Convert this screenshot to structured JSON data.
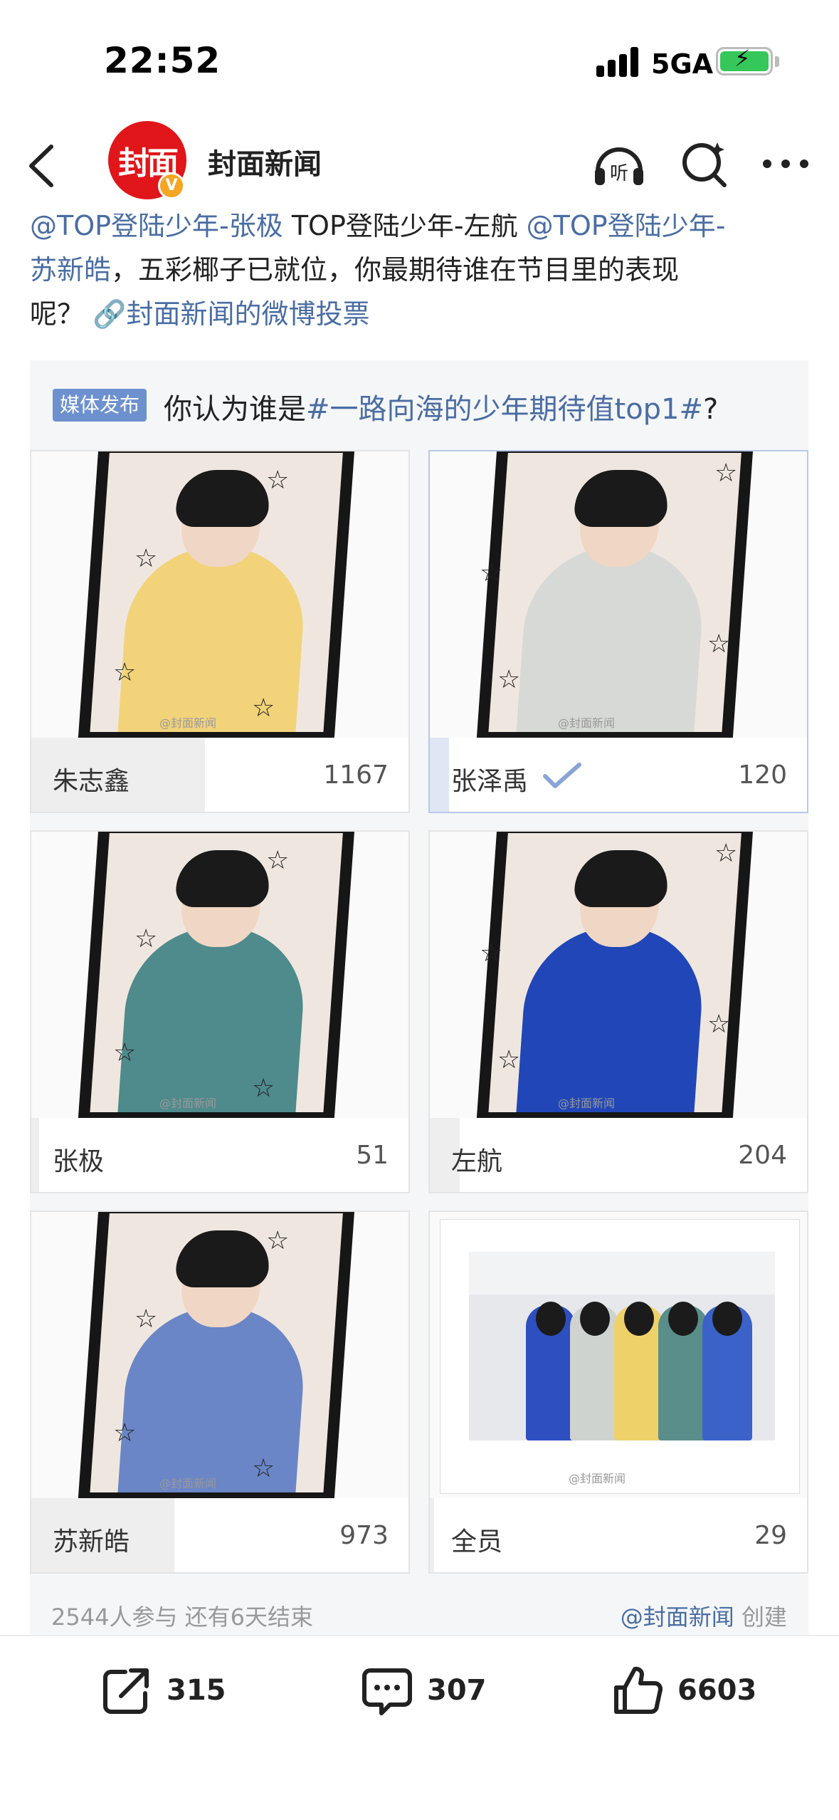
{
  "status_bar": {
    "time": "22:52",
    "network": "5GA"
  },
  "header": {
    "avatar_text": "封面",
    "account_name": "封面新闻"
  },
  "post": {
    "line1_mention1": "@TOP登陆少年-张极",
    "line1_plain": " TOP登陆少年-左航 ",
    "line1_mention2": "@TOP登陆少年-",
    "line2_mention2b": "苏新皓",
    "line2_text": "，五彩椰子已就位，你最期待谁在节目里的表现",
    "line3_text": "呢？",
    "vote_link": "封面新闻的微博投票"
  },
  "poll": {
    "tag": "媒体发布",
    "question_prefix": "你认为谁是",
    "question_topic": "#一路向海的少年期待值top1#",
    "question_suffix": "?",
    "options": [
      {
        "name": "朱志鑫",
        "count": "1167",
        "fraction": 0.46,
        "selected": false,
        "outfit": "#f2d37a"
      },
      {
        "name": "张泽禹",
        "count": "120",
        "fraction": 0.05,
        "selected": true,
        "outfit": "#d7d9d6"
      },
      {
        "name": "张极",
        "count": "51",
        "fraction": 0.02,
        "selected": false,
        "outfit": "#4f8a8c"
      },
      {
        "name": "左航",
        "count": "204",
        "fraction": 0.08,
        "selected": false,
        "outfit": "#2146b8"
      },
      {
        "name": "苏新皓",
        "count": "973",
        "fraction": 0.38,
        "selected": false,
        "outfit": "#6b86c6"
      },
      {
        "name": "全员",
        "count": "29",
        "fraction": 0.01,
        "selected": false,
        "outfit": "#cccccc"
      }
    ],
    "participants": "2544人参与",
    "remaining": "还有6天结束",
    "creator": "@封面新闻",
    "creator_suffix": " 创建",
    "watermark": "@封面新闻"
  },
  "actions": {
    "share": "315",
    "comment": "307",
    "like": "6603"
  },
  "colors": {
    "link": "#4a6da3",
    "tag": "#6d90cf",
    "avatar": "#e0161a"
  }
}
